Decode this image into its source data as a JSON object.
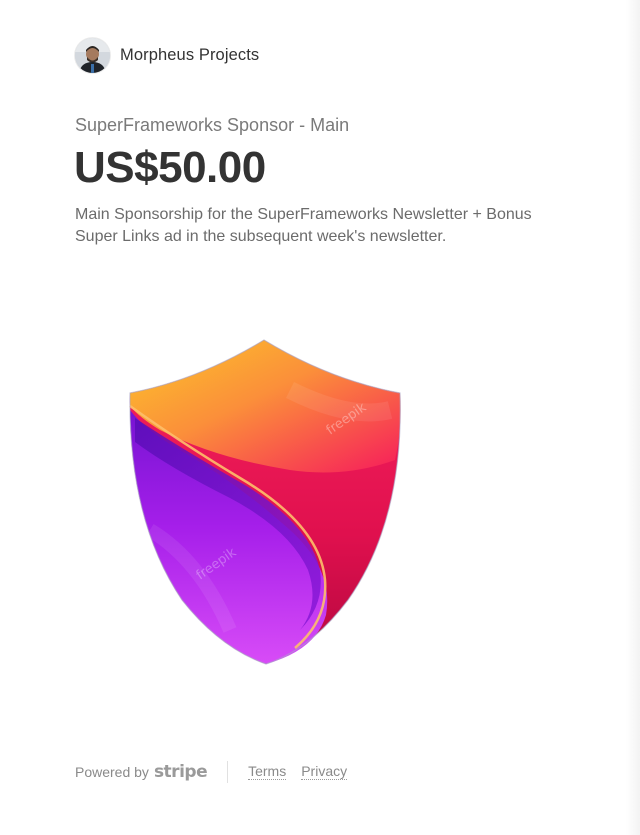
{
  "merchant": {
    "name": "Morpheus Projects",
    "avatar_icon": "user-avatar"
  },
  "product": {
    "name": "SuperFrameworks Sponsor - Main",
    "price": "US$50.00",
    "description": "Main Sponsorship for the SuperFrameworks Newsletter + Bonus Super Links ad in the subsequent week's newsletter.",
    "image_icon": "shield-logo",
    "watermark_text": "freepik"
  },
  "footer": {
    "powered_by": "Powered by",
    "brand": "stripe",
    "terms_label": "Terms",
    "privacy_label": "Privacy"
  },
  "colors": {
    "shield_top": "#FBBF24",
    "shield_orange": "#FB7A3C",
    "shield_pink": "#F5165E",
    "shield_purple": "#7B16D6",
    "shield_violet": "#C13DF5"
  }
}
